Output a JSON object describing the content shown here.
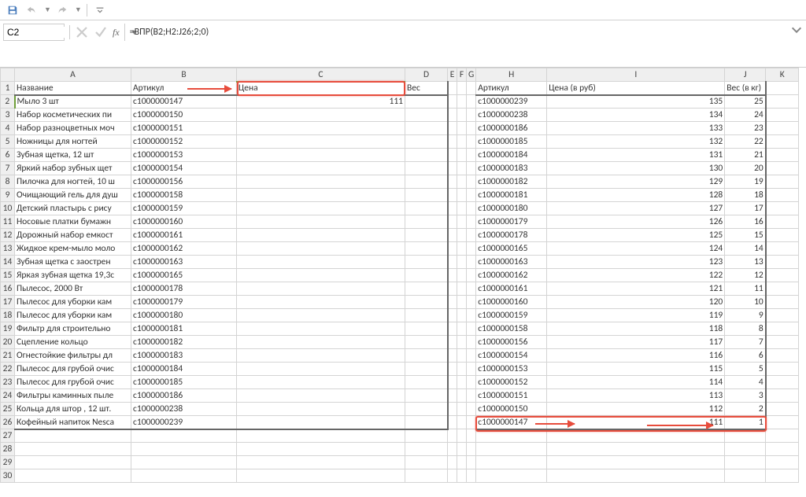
{
  "qat": {
    "save": "save",
    "undo": "undo",
    "redo": "redo",
    "customize": "customize"
  },
  "fbar": {
    "cell_ref": "C2",
    "formula": "=ВПР(B2;H2:J26;2;0)"
  },
  "columns": [
    "A",
    "B",
    "C",
    "D",
    "E",
    "F",
    "G",
    "H",
    "I",
    "J",
    "K"
  ],
  "rows": [
    1,
    2,
    3,
    4,
    5,
    6,
    7,
    8,
    9,
    10,
    11,
    12,
    13,
    14,
    15,
    16,
    17,
    18,
    19,
    20,
    21,
    22,
    23,
    24,
    25,
    26,
    27,
    28,
    29,
    30
  ],
  "left_headers": {
    "A": "Название",
    "B": "Артикул",
    "C": "Цена",
    "D": "Вес"
  },
  "right_headers": {
    "H": "Артикул",
    "I": "Цена (в руб)",
    "J": "Вес (в кг)"
  },
  "left_table": [
    {
      "name": "Мыло 3 шт",
      "art": "с1000000147",
      "price": "111",
      "weight": ""
    },
    {
      "name": "Набор косметических пи",
      "art": "с1000000150",
      "price": "",
      "weight": ""
    },
    {
      "name": "Набор разноцветных моч",
      "art": "с1000000151",
      "price": "",
      "weight": ""
    },
    {
      "name": "Ножницы для ногтей",
      "art": "с1000000152",
      "price": "",
      "weight": ""
    },
    {
      "name": "Зубная щетка, 12 шт",
      "art": "с1000000153",
      "price": "",
      "weight": ""
    },
    {
      "name": "Яркий набор зубных щет",
      "art": "с1000000154",
      "price": "",
      "weight": ""
    },
    {
      "name": "Пилочка для ногтей, 10 ш",
      "art": "с1000000156",
      "price": "",
      "weight": ""
    },
    {
      "name": "Очищающий гель для душ",
      "art": "с1000000158",
      "price": "",
      "weight": ""
    },
    {
      "name": "Детский пластырь с рису",
      "art": "с1000000159",
      "price": "",
      "weight": ""
    },
    {
      "name": "Носовые платки бумажн",
      "art": "с1000000160",
      "price": "",
      "weight": ""
    },
    {
      "name": "Дорожный набор емкост",
      "art": "с1000000161",
      "price": "",
      "weight": ""
    },
    {
      "name": "Жидкое крем-мыло моло",
      "art": "с1000000162",
      "price": "",
      "weight": ""
    },
    {
      "name": "Зубная щетка с заострен",
      "art": "с1000000163",
      "price": "",
      "weight": ""
    },
    {
      "name": "Яркая зубная щетка 19,3с",
      "art": "с1000000165",
      "price": "",
      "weight": ""
    },
    {
      "name": "Пылесос, 2000 Вт",
      "art": "с1000000178",
      "price": "",
      "weight": ""
    },
    {
      "name": "Пылесос для уборки кам",
      "art": "с1000000179",
      "price": "",
      "weight": ""
    },
    {
      "name": "Пылесос для уборки кам",
      "art": "с1000000180",
      "price": "",
      "weight": ""
    },
    {
      "name": "Фильтр для строительно",
      "art": "с1000000181",
      "price": "",
      "weight": ""
    },
    {
      "name": "Сцепление кольцо",
      "art": "с1000000182",
      "price": "",
      "weight": ""
    },
    {
      "name": "Огнестойкие фильтры дл",
      "art": "с1000000183",
      "price": "",
      "weight": ""
    },
    {
      "name": "Пылесос для грубой очис",
      "art": "с1000000184",
      "price": "",
      "weight": ""
    },
    {
      "name": "Пылесос для грубой очис",
      "art": "с1000000185",
      "price": "",
      "weight": ""
    },
    {
      "name": "Фильтры каминных пыле",
      "art": "с1000000186",
      "price": "",
      "weight": ""
    },
    {
      "name": "Кольца для штор , 12 шт.",
      "art": "с1000000238",
      "price": "",
      "weight": ""
    },
    {
      "name": "Кофейный напиток Nesca",
      "art": "с1000000239",
      "price": "",
      "weight": ""
    }
  ],
  "right_table": [
    {
      "art": "с1000000239",
      "price": "135",
      "weight": "25"
    },
    {
      "art": "с1000000238",
      "price": "134",
      "weight": "24"
    },
    {
      "art": "с1000000186",
      "price": "133",
      "weight": "23"
    },
    {
      "art": "с1000000185",
      "price": "132",
      "weight": "22"
    },
    {
      "art": "с1000000184",
      "price": "131",
      "weight": "21"
    },
    {
      "art": "с1000000183",
      "price": "130",
      "weight": "20"
    },
    {
      "art": "с1000000182",
      "price": "129",
      "weight": "19"
    },
    {
      "art": "с1000000181",
      "price": "128",
      "weight": "18"
    },
    {
      "art": "с1000000180",
      "price": "127",
      "weight": "17"
    },
    {
      "art": "с1000000179",
      "price": "126",
      "weight": "16"
    },
    {
      "art": "с1000000178",
      "price": "125",
      "weight": "15"
    },
    {
      "art": "с1000000165",
      "price": "124",
      "weight": "14"
    },
    {
      "art": "с1000000163",
      "price": "123",
      "weight": "13"
    },
    {
      "art": "с1000000162",
      "price": "122",
      "weight": "12"
    },
    {
      "art": "с1000000161",
      "price": "121",
      "weight": "11"
    },
    {
      "art": "с1000000160",
      "price": "120",
      "weight": "10"
    },
    {
      "art": "с1000000159",
      "price": "119",
      "weight": "9"
    },
    {
      "art": "с1000000158",
      "price": "118",
      "weight": "8"
    },
    {
      "art": "с1000000156",
      "price": "117",
      "weight": "7"
    },
    {
      "art": "с1000000154",
      "price": "116",
      "weight": "6"
    },
    {
      "art": "с1000000153",
      "price": "115",
      "weight": "5"
    },
    {
      "art": "с1000000152",
      "price": "114",
      "weight": "4"
    },
    {
      "art": "с1000000151",
      "price": "113",
      "weight": "3"
    },
    {
      "art": "с1000000150",
      "price": "112",
      "weight": "2"
    },
    {
      "art": "с1000000147",
      "price": "111",
      "weight": "1"
    }
  ],
  "active_cell": "C2"
}
